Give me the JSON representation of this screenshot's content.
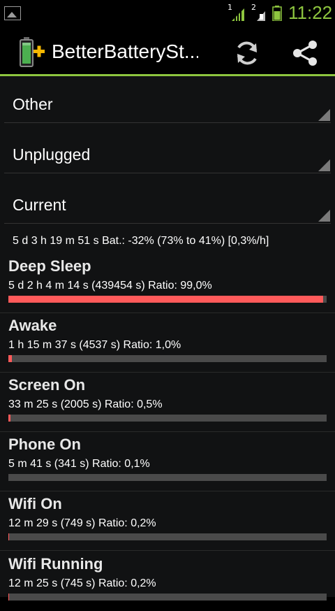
{
  "status_bar": {
    "time": "11:22",
    "sim1_label": "1",
    "sim2_label": "2"
  },
  "action_bar": {
    "title": "BetterBatterySt..."
  },
  "spinners": [
    {
      "value": "Other"
    },
    {
      "value": "Unplugged"
    },
    {
      "value": "Current"
    }
  ],
  "summary": "5 d 3 h 19 m 51 s  Bat.: -32% (73% to 41%) [0,3%/h]",
  "rows": [
    {
      "title": "Deep Sleep",
      "detail": "5 d 2 h 4 m 14 s  (439454 s) Ratio: 99,0%",
      "ratio": 0.99
    },
    {
      "title": "Awake",
      "detail": "1 h 15 m 37 s  (4537 s) Ratio: 1,0%",
      "ratio": 0.01
    },
    {
      "title": "Screen On",
      "detail": "33 m 25 s  (2005 s) Ratio: 0,5%",
      "ratio": 0.005
    },
    {
      "title": "Phone On",
      "detail": "5 m 41 s  (341 s) Ratio: 0,1%",
      "ratio": 0.001
    },
    {
      "title": "Wifi On",
      "detail": "12 m 29 s  (749 s) Ratio: 0,2%",
      "ratio": 0.002
    },
    {
      "title": "Wifi Running",
      "detail": "12 m 25 s  (745 s) Ratio: 0,2%",
      "ratio": 0.002
    }
  ],
  "colors": {
    "accent": "#8ec63f",
    "bar_fill": "#ff5a5a",
    "bar_track": "#4a4a4a"
  }
}
